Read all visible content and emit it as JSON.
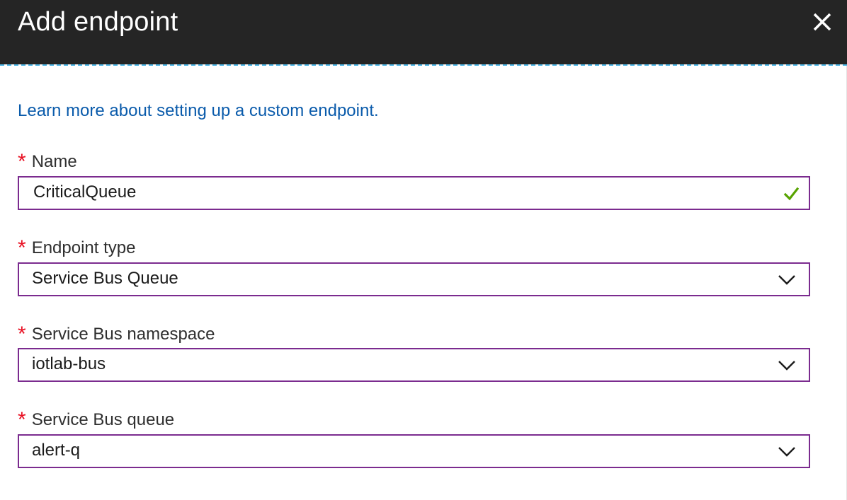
{
  "header": {
    "title": "Add endpoint",
    "close_icon": "close-icon"
  },
  "learn_more_link": "Learn more about setting up a custom endpoint.",
  "form": {
    "required_marker": "*",
    "name": {
      "label": "Name",
      "value": "CriticalQueue",
      "status_icon": "checkmark-icon"
    },
    "endpoint_type": {
      "label": "Endpoint type",
      "value": "Service Bus Queue"
    },
    "namespace": {
      "label": "Service Bus namespace",
      "value": "iotlab-bus"
    },
    "queue": {
      "label": "Service Bus queue",
      "value": "alert-q"
    }
  },
  "colors": {
    "header_bg": "#252525",
    "accent_dashed_rule": "#4db8e8",
    "link": "#0a5bab",
    "required": "#e81123",
    "field_border": "#7b2b8f",
    "valid_check": "#57a300"
  }
}
